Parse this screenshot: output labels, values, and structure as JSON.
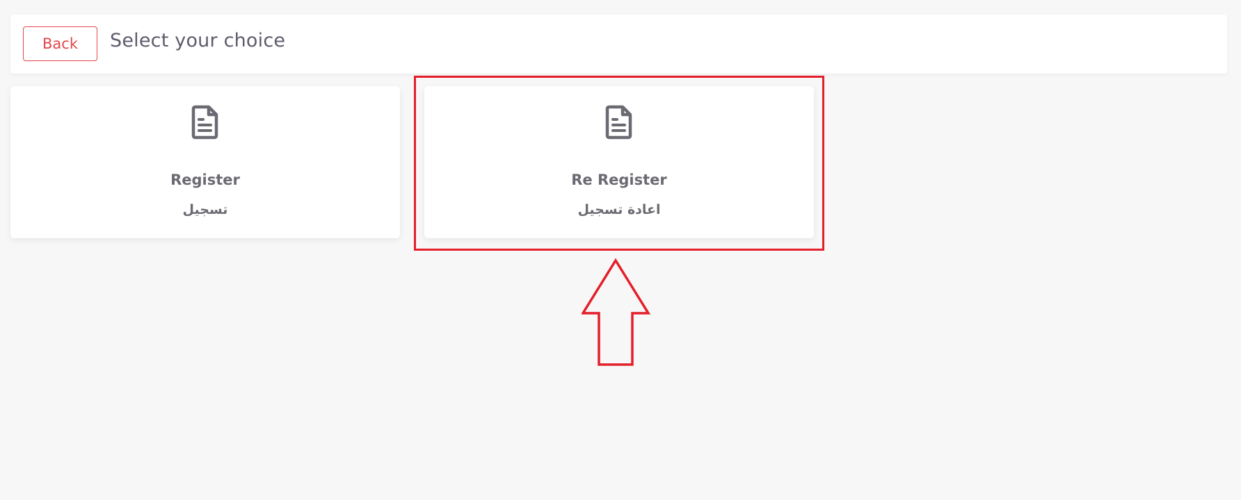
{
  "header": {
    "back_label": "Back",
    "title": "Select your choice"
  },
  "cards": [
    {
      "title": "Register",
      "subtitle": "تسجيل",
      "icon": "document-icon"
    },
    {
      "title": "Re Register",
      "subtitle": "اعادة تسجيل",
      "icon": "document-icon"
    }
  ],
  "annotation": {
    "highlight_target": "card-re-register",
    "color": "#e41e2a"
  },
  "colors": {
    "background": "#f7f7f7",
    "accent": "#e0474c",
    "text": "#5d5b6c",
    "icon": "#6a6a72"
  }
}
